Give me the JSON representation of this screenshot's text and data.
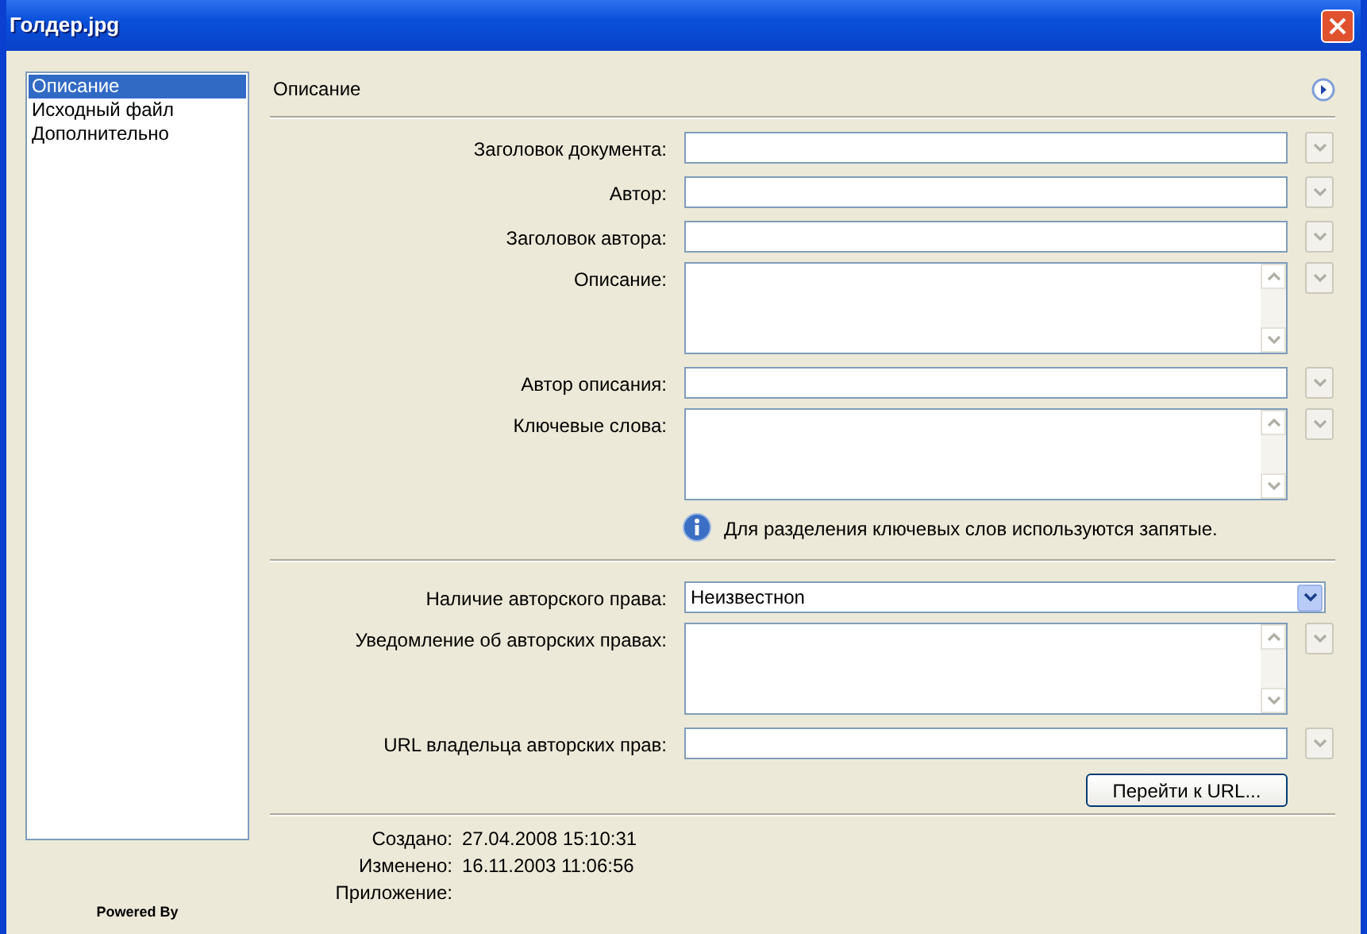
{
  "window": {
    "title": "Голдер.jpg"
  },
  "sidebar": {
    "items": [
      {
        "label": "Описание",
        "selected": true
      },
      {
        "label": "Исходный файл",
        "selected": false
      },
      {
        "label": "Дополнительно",
        "selected": false
      }
    ],
    "footer": "Powered By"
  },
  "section": {
    "title": "Описание"
  },
  "fields": [
    {
      "label": "Заголовок документа:",
      "kind": "text"
    },
    {
      "label": "Автор:",
      "kind": "text"
    },
    {
      "label": "Заголовок автора:",
      "kind": "text"
    },
    {
      "label": "Описание:",
      "kind": "textarea"
    },
    {
      "label": "Автор описания:",
      "kind": "text"
    },
    {
      "label": "Ключевые слова:",
      "kind": "textarea"
    },
    {
      "kind": "hint",
      "text": "Для разделения ключевых слов используются запятые."
    },
    {
      "kind": "divider"
    },
    {
      "label": "Наличие авторского права:",
      "kind": "select",
      "value": "Неизвестноn"
    },
    {
      "label": "Уведомление об авторских правах:",
      "kind": "textarea"
    },
    {
      "label": "URL владельца авторских прав:",
      "kind": "text"
    },
    {
      "kind": "button",
      "text": "Перейти к URL..."
    }
  ],
  "info": [
    {
      "label": "Создано:",
      "value": "27.04.2008 15:10:31"
    },
    {
      "label": "Изменено:",
      "value": "16.11.2003 11:06:56"
    },
    {
      "label": "Приложение:"
    }
  ]
}
